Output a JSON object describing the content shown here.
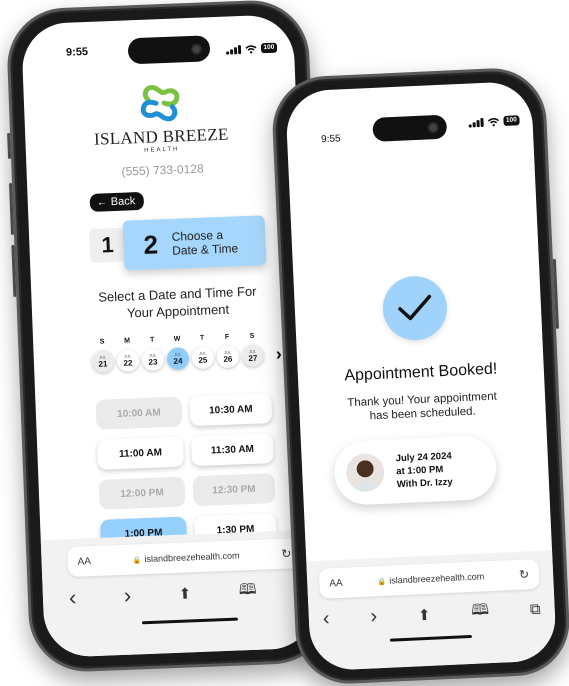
{
  "phone1": {
    "status": {
      "time": "9:55",
      "battery": "100"
    },
    "brand": {
      "name": "ISLAND BREEZE",
      "sub": "HEALTH",
      "phone": "(555) 733-0128",
      "colors": {
        "green": "#7cc142",
        "blue": "#1f8fd6"
      }
    },
    "back_label": "Back",
    "steps": {
      "step1": "1",
      "step2_num": "2",
      "step2_label_line1": "Choose a",
      "step2_label_line2": "Date & Time"
    },
    "select_title_line1": "Select a Date and Time For",
    "select_title_line2": "Your Appointment",
    "days": [
      {
        "dow": "S",
        "month": "JUL",
        "day": "21",
        "state": "muted"
      },
      {
        "dow": "M",
        "month": "JUL",
        "day": "22",
        "state": "available"
      },
      {
        "dow": "T",
        "month": "JUL",
        "day": "23",
        "state": "available"
      },
      {
        "dow": "W",
        "month": "JUL",
        "day": "24",
        "state": "selected"
      },
      {
        "dow": "T",
        "month": "JUL",
        "day": "25",
        "state": "available"
      },
      {
        "dow": "F",
        "month": "JUL",
        "day": "26",
        "state": "available"
      },
      {
        "dow": "S",
        "month": "JUL",
        "day": "27",
        "state": "muted"
      }
    ],
    "next_icon": "chevron-right-icon",
    "slots": [
      {
        "time": "10:00 AM",
        "state": "unavailable"
      },
      {
        "time": "10:30 AM",
        "state": "available"
      },
      {
        "time": "11:00 AM",
        "state": "available"
      },
      {
        "time": "11:30 AM",
        "state": "available"
      },
      {
        "time": "12:00 PM",
        "state": "unavailable"
      },
      {
        "time": "12:30 PM",
        "state": "unavailable"
      },
      {
        "time": "1:00 PM",
        "state": "selected"
      },
      {
        "time": "1:30 PM",
        "state": "available"
      }
    ],
    "browser": {
      "aa": "AA",
      "url": "islandbreezehealth.com"
    }
  },
  "phone2": {
    "status": {
      "time": "9:55",
      "battery": "100"
    },
    "title": "Appointment Booked!",
    "subtitle_line1": "Thank you! Your appointment",
    "subtitle_line2": "has been scheduled.",
    "appointment": {
      "date": "July 24 2024",
      "time": "at 1:00 PM",
      "doctor": "With Dr. Izzy"
    },
    "browser": {
      "aa": "AA",
      "url": "islandbreezehealth.com"
    }
  },
  "colors": {
    "accent_blue": "#a6d6fb",
    "selected_blue": "#8fcdfb"
  },
  "icons": {
    "back_arrow": "←",
    "chevron_right": "›",
    "lock": "🔒",
    "reload": "↻",
    "nav_back": "‹",
    "nav_forward": "›",
    "share": "⬆",
    "bookmarks": "🕮",
    "tabs": "⧉"
  }
}
